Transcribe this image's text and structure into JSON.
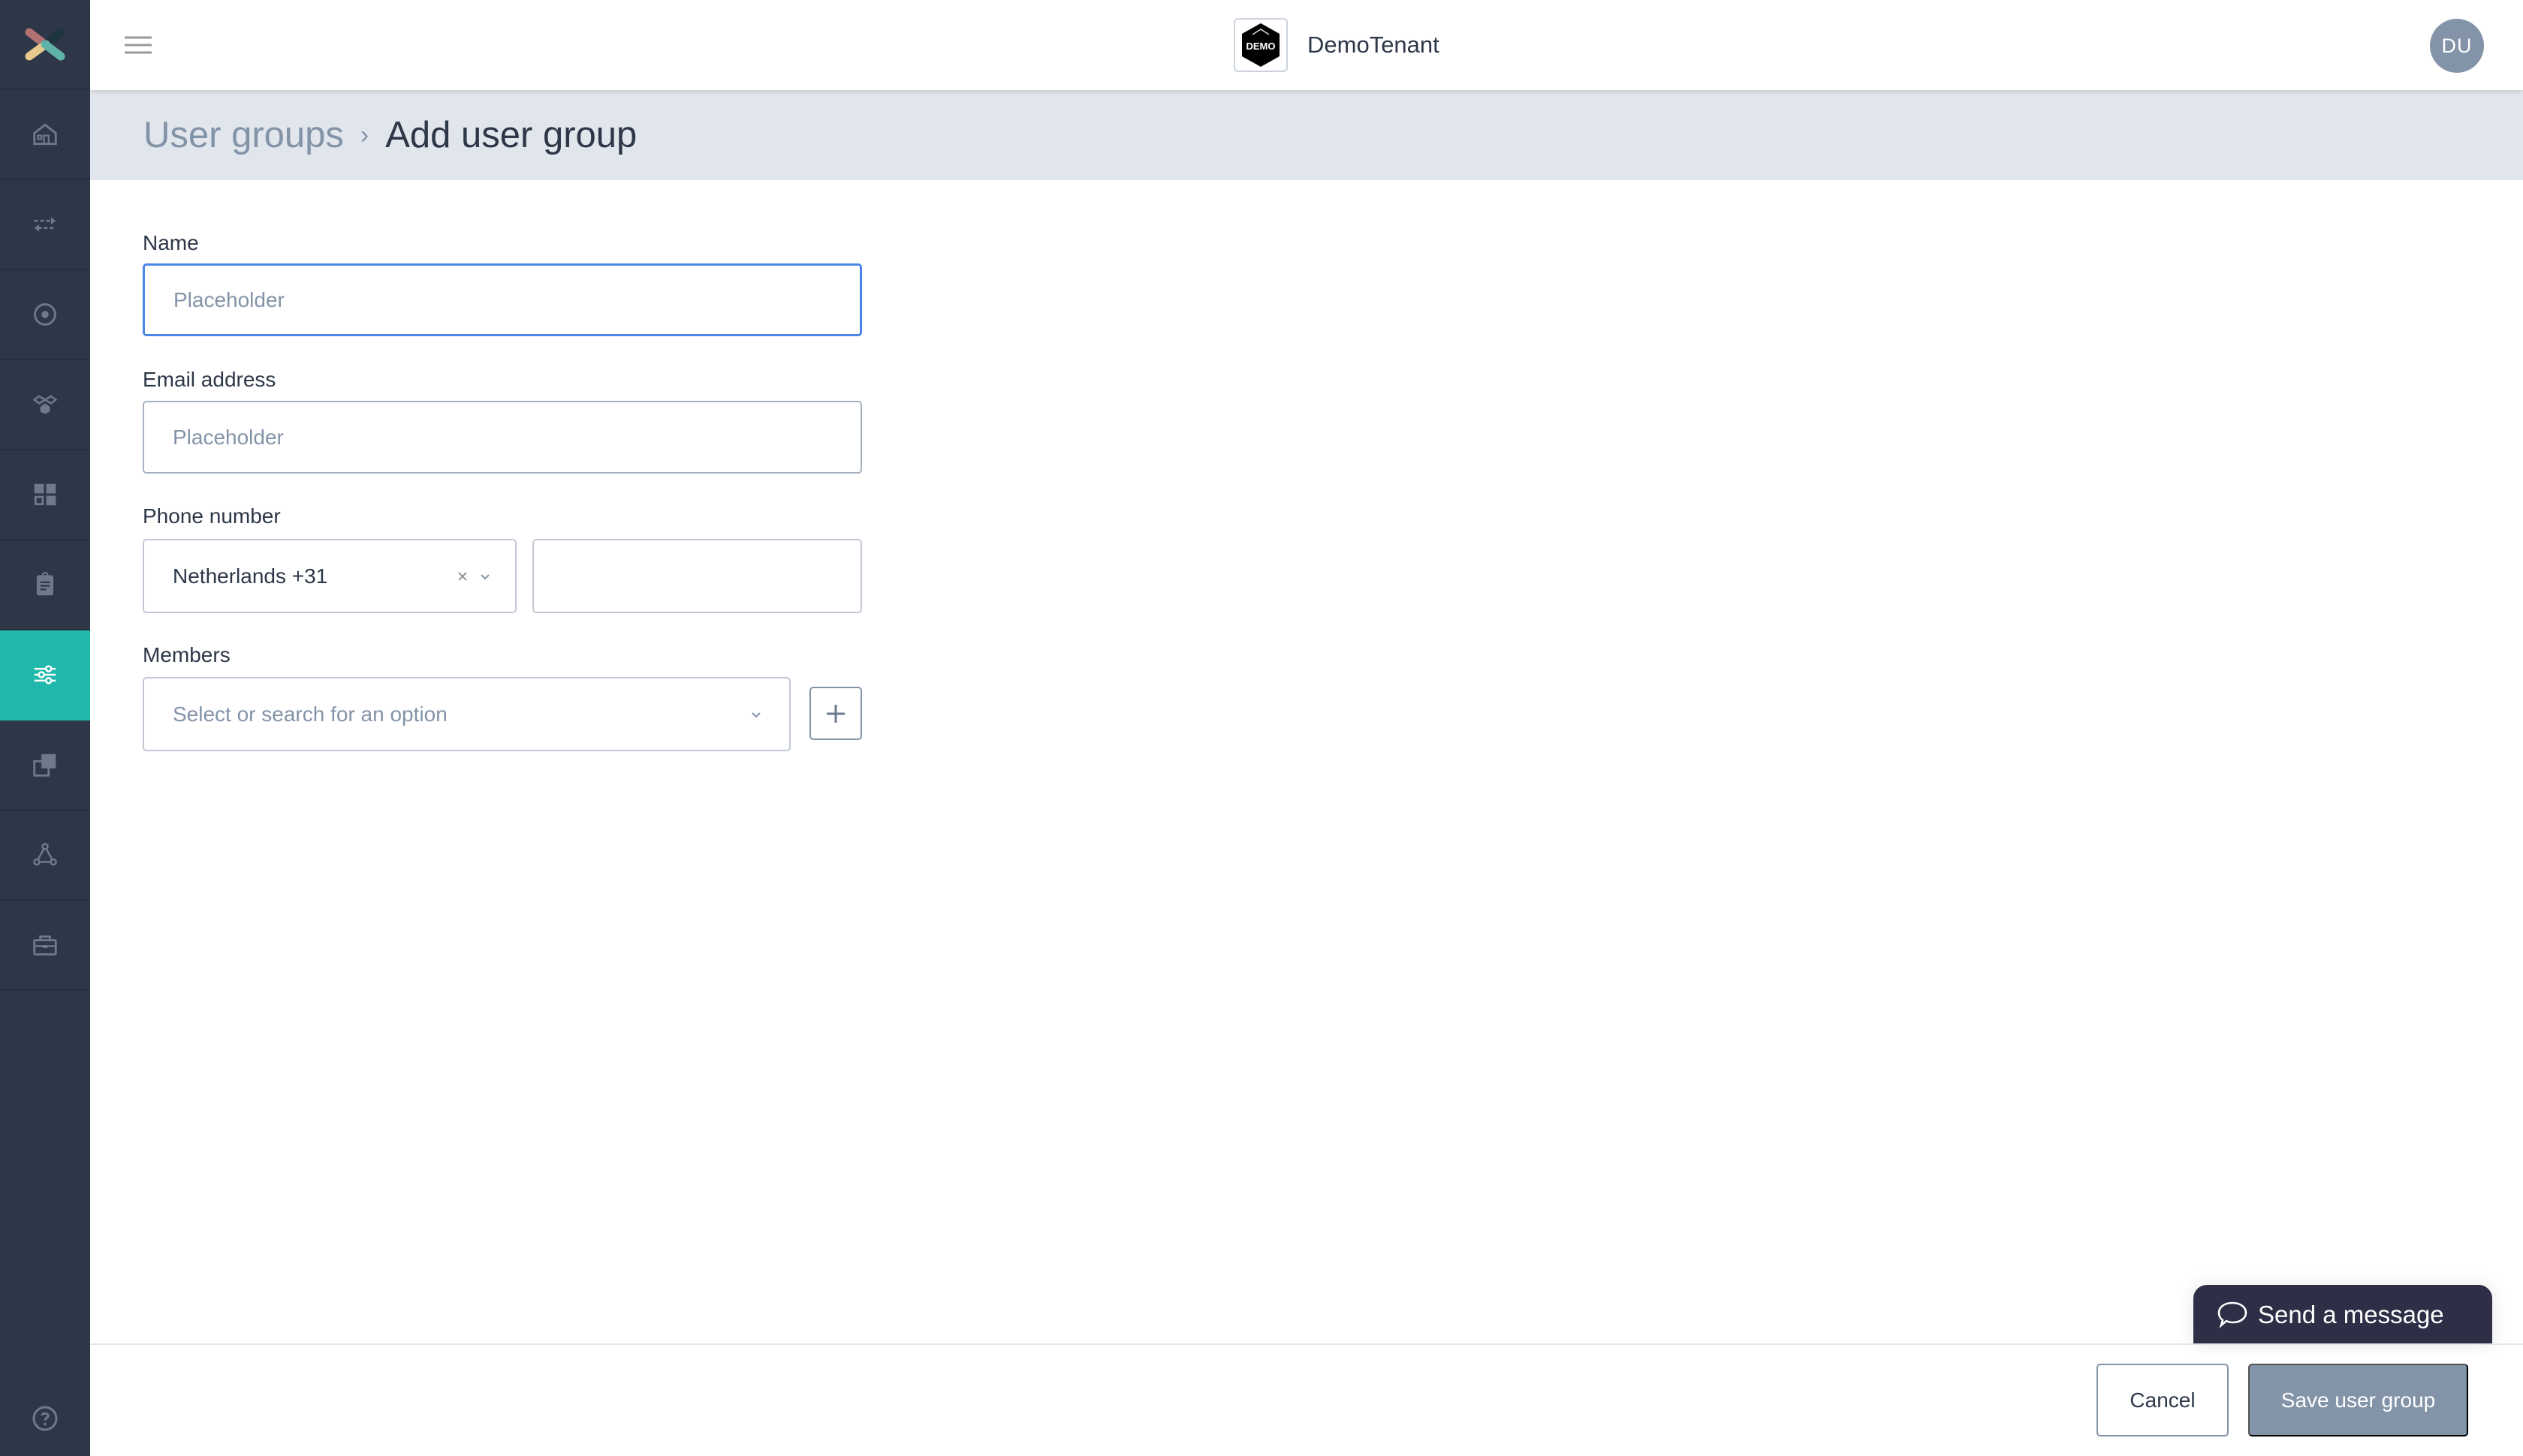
{
  "sidebar": {
    "items": [
      {
        "name": "home",
        "icon": "home-icon"
      },
      {
        "name": "transfers",
        "icon": "arrows-exchange-icon"
      },
      {
        "name": "radio",
        "icon": "target-circle-icon"
      },
      {
        "name": "integrations",
        "icon": "hexagon-link-icon"
      },
      {
        "name": "dashboard",
        "icon": "grid-icon"
      },
      {
        "name": "reports",
        "icon": "clipboard-icon"
      },
      {
        "name": "settings",
        "icon": "sliders-icon",
        "active": true
      },
      {
        "name": "copy",
        "icon": "copy-squares-icon"
      },
      {
        "name": "network",
        "icon": "triangle-nodes-icon"
      },
      {
        "name": "toolbox",
        "icon": "toolbox-icon"
      }
    ],
    "help_icon": "help-circle-icon"
  },
  "header": {
    "tenant_logo_text": "DEMO",
    "tenant_name": "DemoTenant",
    "avatar_initials": "DU"
  },
  "breadcrumb": {
    "parent": "User groups",
    "separator": "›",
    "current": "Add user group"
  },
  "form": {
    "name": {
      "label": "Name",
      "placeholder": "Placeholder",
      "value": ""
    },
    "email": {
      "label": "Email address",
      "placeholder": "Placeholder",
      "value": ""
    },
    "phone": {
      "label": "Phone number",
      "country_value": "Netherlands +31",
      "number_value": ""
    },
    "members": {
      "label": "Members",
      "placeholder": "Select or search for an option"
    }
  },
  "footer": {
    "cancel_label": "Cancel",
    "save_label": "Save user group"
  },
  "chat_widget": {
    "label": "Send a message"
  },
  "colors": {
    "sidebar_bg": "#2d3748",
    "accent": "#20b8aa",
    "focus": "#4a86e8",
    "muted": "#8393a8",
    "chat_bg": "#2e2e46"
  }
}
